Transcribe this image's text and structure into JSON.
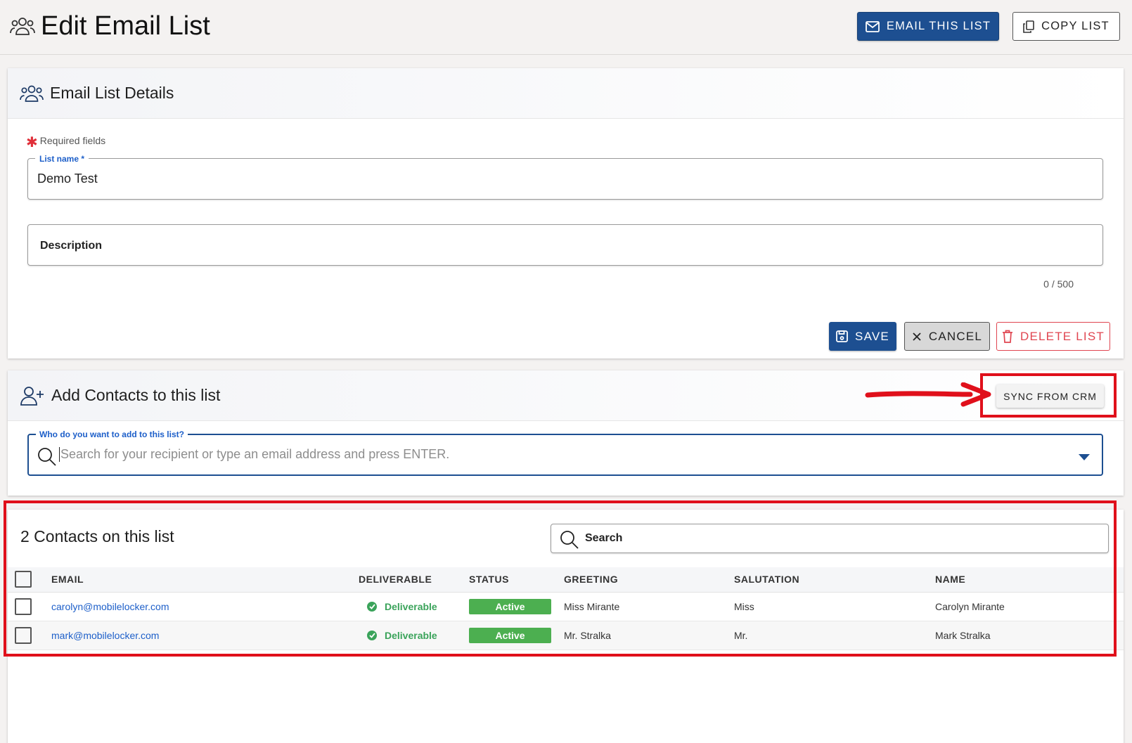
{
  "header": {
    "title": "Edit Email List",
    "email_button": "EMAIL THIS LIST",
    "copy_button": "COPY LIST"
  },
  "details": {
    "title": "Email List Details",
    "required_note": "Required fields",
    "list_name_label": "List name *",
    "list_name_value": "Demo Test",
    "description_placeholder": "Description",
    "description_counter": "0 / 500",
    "save_button": "SAVE",
    "cancel_button": "CANCEL",
    "delete_button": "DELETE LIST"
  },
  "add_contacts": {
    "title": "Add Contacts to this list",
    "sync_button": "SYNC FROM CRM",
    "search_label": "Who do you want to add to this list?",
    "search_placeholder": "Search for your recipient or type an email address and press ENTER."
  },
  "contacts": {
    "title": "2 Contacts on this list",
    "search_label": "Search",
    "columns": [
      "EMAIL",
      "DELIVERABLE",
      "STATUS",
      "GREETING",
      "SALUTATION",
      "NAME"
    ],
    "rows": [
      {
        "email": "carolyn@mobilelocker.com",
        "deliverable": "Deliverable",
        "status": "Active",
        "greeting": "Miss Mirante",
        "salutation": "Miss",
        "name": "Carolyn Mirante"
      },
      {
        "email": "mark@mobilelocker.com",
        "deliverable": "Deliverable",
        "status": "Active",
        "greeting": "Mr. Stralka",
        "salutation": "Mr.",
        "name": "Mark Stralka"
      }
    ]
  },
  "colors": {
    "primary": "#1d4f91",
    "danger": "#e04550",
    "success": "#4caf50",
    "annotation": "#e0101b"
  }
}
